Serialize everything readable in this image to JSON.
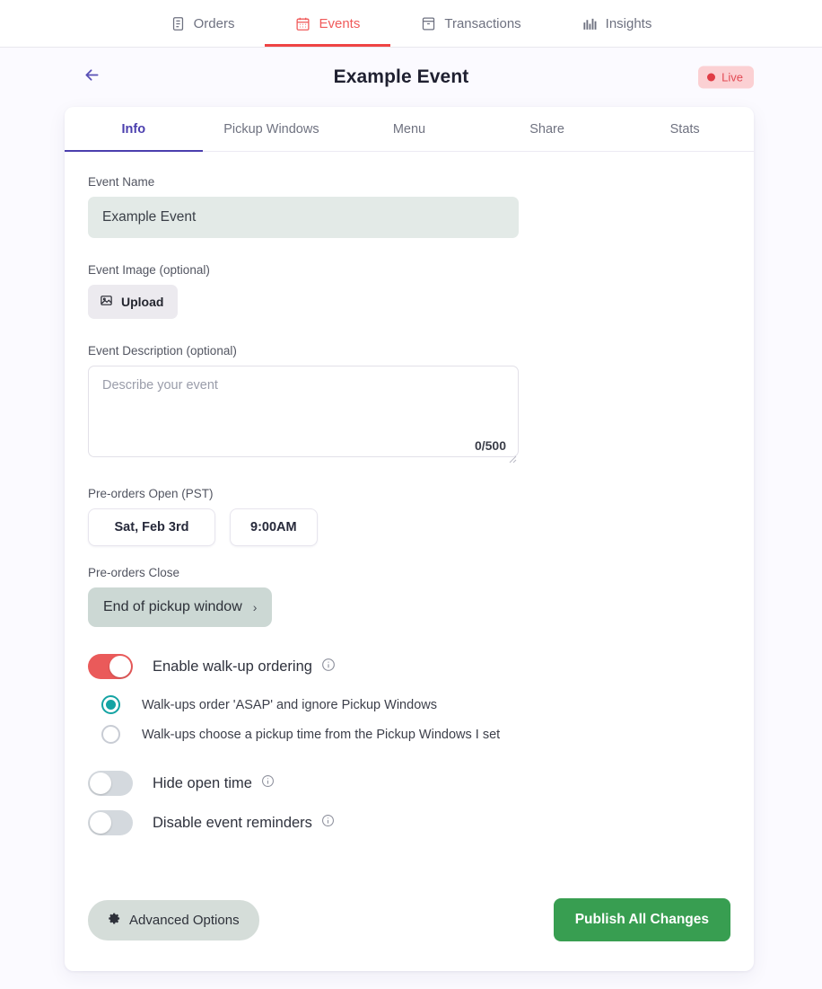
{
  "topnav": {
    "items": [
      {
        "label": "Orders",
        "icon": "document-list-icon",
        "active": false
      },
      {
        "label": "Events",
        "icon": "calendar-icon",
        "active": true
      },
      {
        "label": "Transactions",
        "icon": "archive-box-icon",
        "active": false
      },
      {
        "label": "Insights",
        "icon": "bar-chart-icon",
        "active": false
      }
    ]
  },
  "header": {
    "back_icon": "arrow-left-icon",
    "title": "Example Event",
    "status_badge": "Live"
  },
  "tabs": [
    {
      "label": "Info",
      "active": true
    },
    {
      "label": "Pickup Windows",
      "active": false
    },
    {
      "label": "Menu",
      "active": false
    },
    {
      "label": "Share",
      "active": false
    },
    {
      "label": "Stats",
      "active": false
    }
  ],
  "form": {
    "event_name": {
      "label": "Event Name",
      "value": "Example Event",
      "placeholder": "Event Name"
    },
    "event_image": {
      "label": "Event Image (optional)",
      "upload_label": "Upload",
      "icon": "image-icon"
    },
    "event_description": {
      "label": "Event Description (optional)",
      "value": "",
      "placeholder": "Describe your event",
      "char_count": "0/500"
    },
    "preorders_open": {
      "label": "Pre-orders Open (PST)",
      "date": "Sat, Feb 3rd",
      "time": "9:00AM"
    },
    "preorders_close": {
      "label": "Pre-orders Close",
      "value": "End of pickup window",
      "chevron": "chevron-right-icon"
    },
    "walkup": {
      "label": "Enable walk-up ordering",
      "enabled": true,
      "info_icon": "info-icon",
      "options": [
        {
          "label": "Walk-ups order 'ASAP' and ignore Pickup Windows",
          "selected": true
        },
        {
          "label": "Walk-ups choose a pickup time from the Pickup Windows I set",
          "selected": false
        }
      ]
    },
    "hide_open_time": {
      "label": "Hide open time",
      "enabled": false,
      "info_icon": "info-icon"
    },
    "disable_reminders": {
      "label": "Disable event reminders",
      "enabled": false,
      "info_icon": "info-icon"
    }
  },
  "footer": {
    "advanced_label": "Advanced Options",
    "advanced_icon": "gear-icon",
    "publish_label": "Publish All Changes"
  },
  "colors": {
    "accent_red": "#ef4444",
    "accent_purple": "#4b3fae",
    "accent_teal": "#14a3a3",
    "publish_green": "#389e51",
    "live_badge_bg": "#fbd0d3",
    "live_badge_fg": "#e24b55",
    "page_bg": "#fbfaff",
    "input_bg": "#e3eae7"
  }
}
